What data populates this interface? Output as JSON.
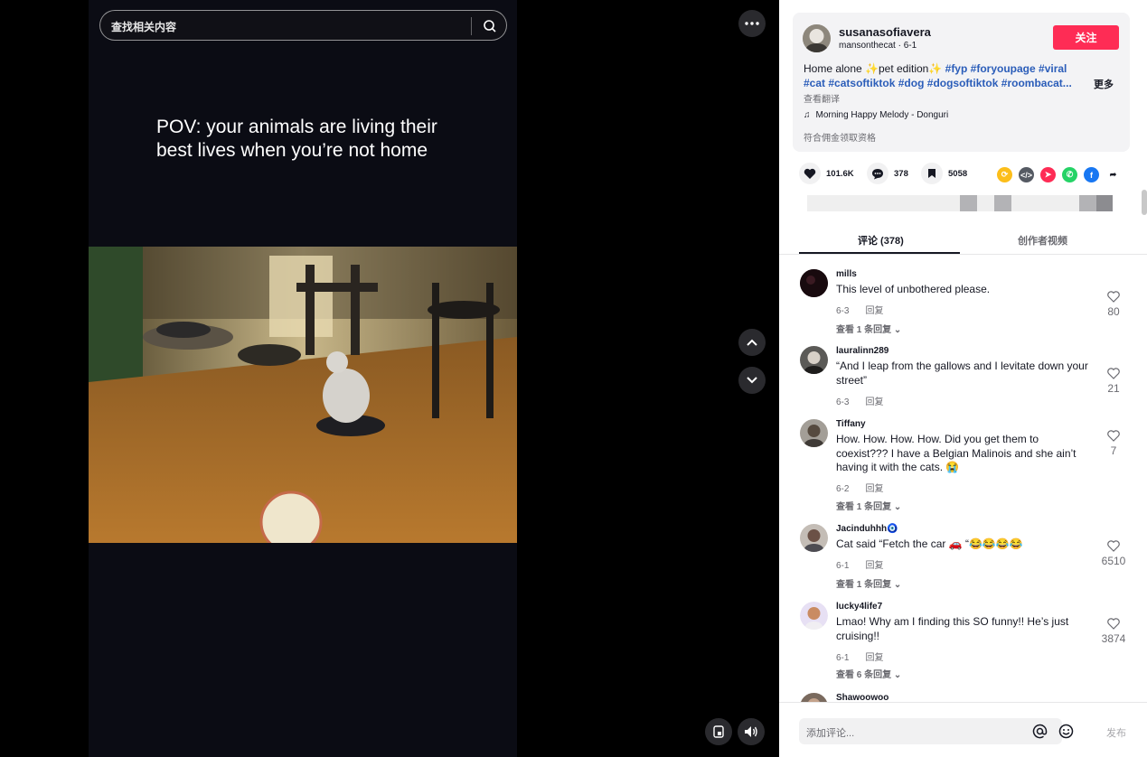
{
  "search": {
    "placeholder": "查找相关内容"
  },
  "video": {
    "overlay_line1": "POV: your animals are living their",
    "overlay_line2": "best lives when you’re not home"
  },
  "author": {
    "username": "susanasofiavera",
    "subline": "mansonthecat · 6-1",
    "follow_label": "关注",
    "desc_text": "Home alone ✨pet edition✨ ",
    "hashtags": [
      "#fyp",
      "#foryoupage",
      "#viral",
      "#cat",
      "#catsoftiktok",
      "#dog",
      "#dogsoftiktok",
      "#roombacat..."
    ],
    "more_label": "更多",
    "translate_label": "查看翻译",
    "music": "Morning Happy Melody - Donguri",
    "commission": "符合佣金领取资格"
  },
  "stats": {
    "likes": "101.6K",
    "comments": "378",
    "saves": "5058"
  },
  "tabs": {
    "comments": "评论 (378)",
    "creator_videos": "创作者视频"
  },
  "comments": [
    {
      "name": "mills",
      "text": "This level of unbothered please.",
      "date": "6-3",
      "reply_label": "回复",
      "likes": "80",
      "replies": "查看 1 条回复"
    },
    {
      "name": "lauralinn289",
      "text": "“And I leap from the gallows and I levitate down your street”",
      "date": "6-3",
      "reply_label": "回复",
      "likes": "21",
      "replies": ""
    },
    {
      "name": "Tiffany",
      "text": "How. How. How. How. Did you get them to coexist??? I have a Belgian Malinois and she ain’t having it with the cats. 😭",
      "date": "6-2",
      "reply_label": "回复",
      "likes": "7",
      "replies": "查看 1 条回复"
    },
    {
      "name": "Jacinduhhh🧿",
      "text": "Cat said “Fetch the car 🚗 “😂😂😂😂",
      "date": "6-1",
      "reply_label": "回复",
      "likes": "6510",
      "replies": "查看 1 条回复"
    },
    {
      "name": "lucky4life7",
      "text": "Lmao! Why am I finding this SO funny!! He’s just cruising!!",
      "date": "6-1",
      "reply_label": "回复",
      "likes": "3874",
      "replies": "查看 6 条回复"
    },
    {
      "name": "Shawoowoo",
      "text": "",
      "date": "",
      "reply_label": "",
      "likes": "",
      "replies": ""
    }
  ],
  "compose": {
    "placeholder": "添加评论...",
    "post_label": "发布"
  },
  "colors": {
    "accent": "#fe2c55",
    "hashtag": "#2b5db9"
  }
}
